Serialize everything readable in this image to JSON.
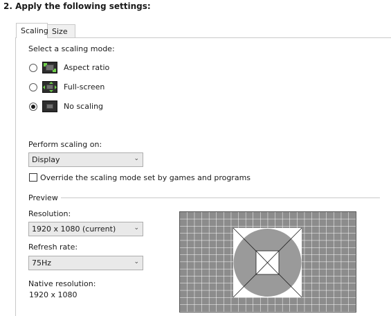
{
  "section_title": "2. Apply the following settings:",
  "tabs": [
    {
      "label": "Scaling",
      "active": true
    },
    {
      "label": "Size",
      "active": false
    }
  ],
  "scaling": {
    "prompt": "Select a scaling mode:",
    "modes": [
      {
        "label": "Aspect ratio",
        "icon": "aspect-ratio-icon",
        "selected": false
      },
      {
        "label": "Full-screen",
        "icon": "full-screen-icon",
        "selected": false
      },
      {
        "label": "No scaling",
        "icon": "no-scaling-icon",
        "selected": true
      }
    ],
    "perform_label": "Perform scaling on:",
    "perform_value": "Display",
    "override_label": "Override the scaling mode set by games and programs",
    "override_checked": false
  },
  "preview": {
    "title": "Preview",
    "resolution_label": "Resolution:",
    "resolution_value": "1920 x 1080 (current)",
    "refresh_label": "Refresh rate:",
    "refresh_value": "75Hz",
    "native_label": "Native resolution:",
    "native_value": "1920 x 1080"
  },
  "colors": {
    "grid_bg": "#8c8c8c",
    "grid_line": "#ffffff",
    "circle": "#9a9a9a"
  }
}
